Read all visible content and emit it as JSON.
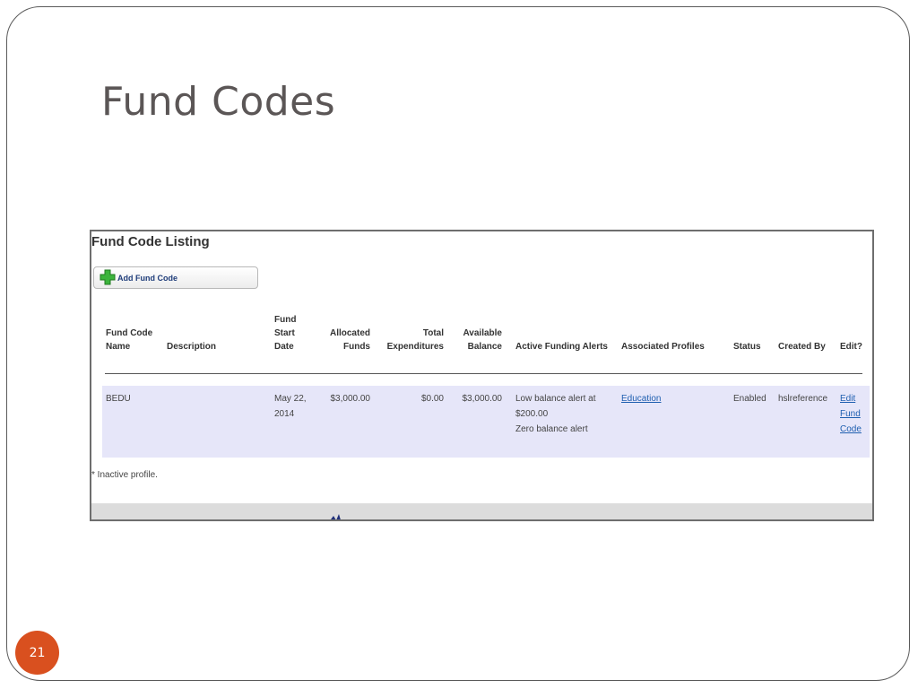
{
  "slide": {
    "title": "Fund Codes",
    "number": "21"
  },
  "listing": {
    "heading": "Fund Code Listing",
    "add_button_label": "Add Fund Code",
    "columns": [
      "Fund Code\nName",
      "Description",
      "Fund\nStart\nDate",
      "Allocated\nFunds",
      "Total\nExpenditures",
      "Available\nBalance",
      "Active Funding Alerts",
      "Associated Profiles",
      "Status",
      "Created By",
      "Edit?"
    ],
    "rows": [
      {
        "name": "BEDU",
        "description": "",
        "start_date_line1": "May 22,",
        "start_date_line2": "2014",
        "allocated": "$3,000.00",
        "expenditures": "$0.00",
        "balance": "$3,000.00",
        "alert_line1": "Low balance alert at",
        "alert_line2": "$200.00",
        "alert_line3": "Zero balance alert",
        "profile": "Education",
        "status": "Enabled",
        "created_by": "hslreference",
        "edit_line1": "Edit",
        "edit_line2": "Fund",
        "edit_line3": "Code"
      }
    ],
    "footnote": "* Inactive profile."
  },
  "icons": {
    "add": "plus-icon",
    "footer": "partial-logo-icon"
  },
  "colors": {
    "slide_number_badge": "#d9501f",
    "row_highlight": "#e6e6f9",
    "link": "#1f5fb0",
    "add_icon": "#3cb43c"
  }
}
